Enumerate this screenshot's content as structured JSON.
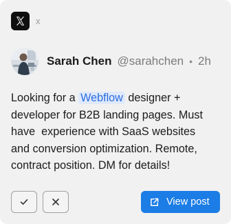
{
  "source": {
    "icon": "x-logo-icon",
    "label": "x"
  },
  "post": {
    "author_name": "Sarah Chen",
    "handle": "@sarahchen",
    "separator": "•",
    "time": "2h",
    "text_before": "Looking for a ",
    "highlight": "Webflow",
    "text_after": " designer +\ndeveloper for B2B landing pages. Must\nhave  experience with SaaS websites\nand conversion optimization. Remote,\ncontract position. DM for details!"
  },
  "actions": {
    "approve_icon": "check-icon",
    "dismiss_icon": "close-icon",
    "view_post_label": "View post",
    "view_post_icon": "external-link-icon"
  },
  "colors": {
    "card_background": "#f1f1f1",
    "accent": "#1b7de5",
    "highlight_background": "#dfe9fb",
    "highlight_text": "#2b6de0"
  }
}
